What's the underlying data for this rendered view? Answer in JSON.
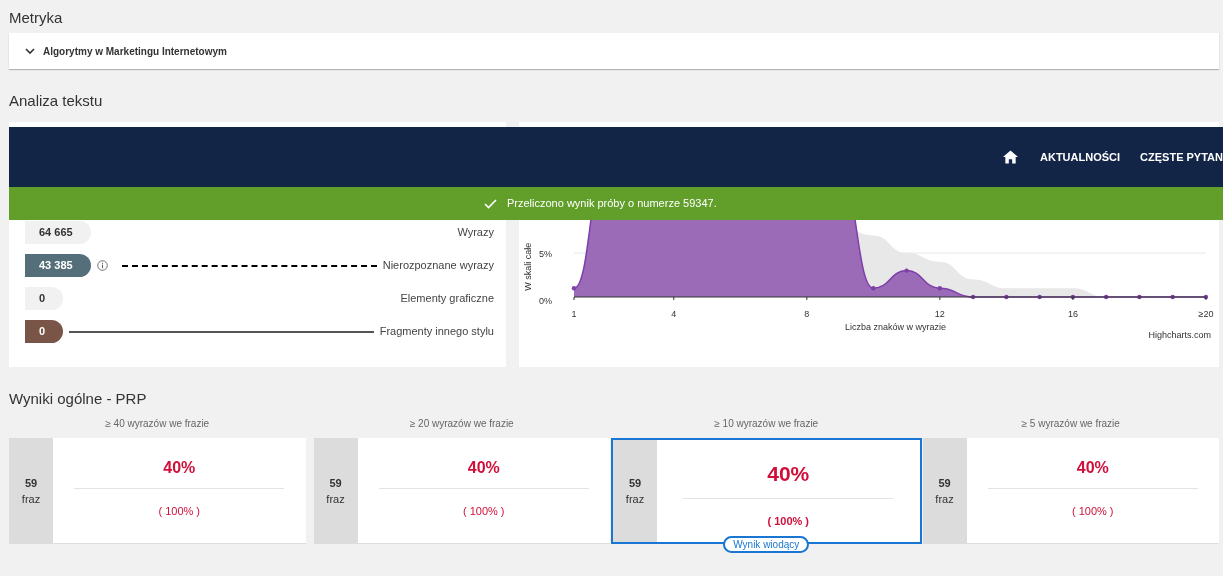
{
  "metric": {
    "title": "Metryka",
    "item": {
      "label": "Algorytmy w Marketingu Internetowym"
    }
  },
  "analysis": {
    "title": "Analiza tekstu",
    "stats": [
      {
        "value": "64 665",
        "label": "Wyrazy",
        "color": "#f1f1f1",
        "kind": "none",
        "info": false
      },
      {
        "value": "43 385",
        "label": "Nierozpoznane wyrazy",
        "color": "#546e7a",
        "kind": "dashed",
        "info": true
      },
      {
        "value": "0",
        "label": "Elementy graficzne",
        "color": "#f1f1f1",
        "kind": "none",
        "info": false
      },
      {
        "value": "0",
        "label": "Fragmenty innego stylu",
        "color": "#795548",
        "kind": "solid",
        "info": false
      }
    ],
    "chart": {
      "ylabel": "W skali całe",
      "yticks": [
        "5%",
        "0%"
      ],
      "xticks": [
        "1",
        "4",
        "8",
        "12",
        "16",
        "≥20"
      ],
      "xlabel": "Liczba znaków w wyrazie",
      "credit": "Highcharts.com"
    }
  },
  "nav": {
    "items": [
      {
        "kind": "home"
      },
      {
        "kind": "link",
        "label": "AKTUALNOŚCI"
      },
      {
        "kind": "link",
        "label": "CZĘSTE PYTAN"
      }
    ]
  },
  "notice": "Przeliczono wynik próby o numerze 59347.",
  "results": {
    "title": "Wyniki ogólne - PRP",
    "cards": [
      {
        "heading": "≥ 40 wyrazów we frazie",
        "count": "59",
        "unit": "fraz",
        "score": "40%",
        "share": "( 100% )",
        "selected": false
      },
      {
        "heading": "≥ 20 wyrazów we frazie",
        "count": "59",
        "unit": "fraz",
        "score": "40%",
        "share": "( 100% )",
        "selected": false
      },
      {
        "heading": "≥ 10 wyrazów we frazie",
        "count": "59",
        "unit": "fraz",
        "score": "40%",
        "share": "( 100% )",
        "selected": true,
        "badge": "Wynik wiodący"
      },
      {
        "heading": "≥ 5 wyrazów we frazie",
        "count": "59",
        "unit": "fraz",
        "score": "40%",
        "share": "( 100% )",
        "selected": false
      }
    ]
  }
}
